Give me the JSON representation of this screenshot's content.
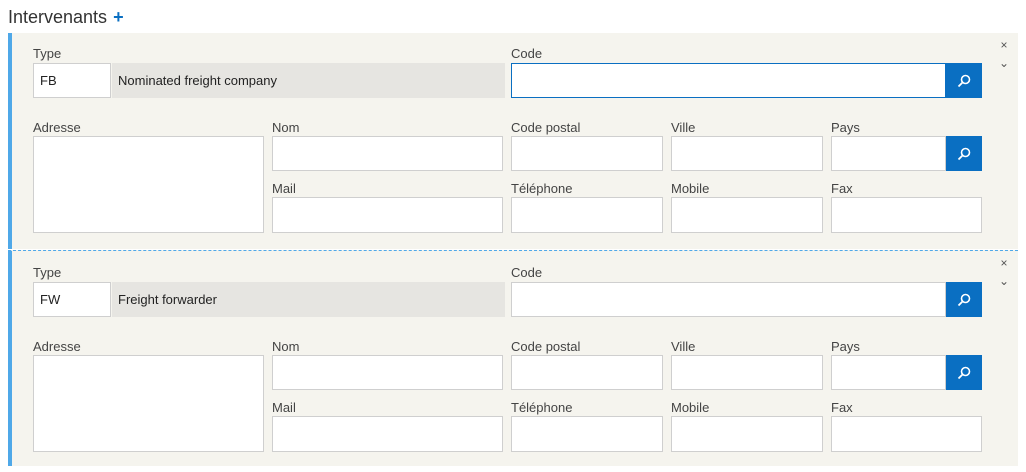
{
  "header": {
    "title": "Intervenants",
    "add_symbol": "+"
  },
  "labels": {
    "type": "Type",
    "code": "Code",
    "adresse": "Adresse",
    "nom": "Nom",
    "code_postal": "Code postal",
    "ville": "Ville",
    "pays": "Pays",
    "mail": "Mail",
    "telephone": "Téléphone",
    "mobile": "Mobile",
    "fax": "Fax"
  },
  "controls": {
    "close": "×",
    "expand": "⌄"
  },
  "intervenants": [
    {
      "type_code": "FB",
      "type_description": "Nominated freight company",
      "code": "",
      "adresse": "",
      "nom": "",
      "code_postal": "",
      "ville": "",
      "pays": "",
      "mail": "",
      "telephone": "",
      "mobile": "",
      "fax": ""
    },
    {
      "type_code": "FW",
      "type_description": "Freight forwarder",
      "code": "",
      "adresse": "",
      "nom": "",
      "code_postal": "",
      "ville": "",
      "pays": "",
      "mail": "",
      "telephone": "",
      "mobile": "",
      "fax": ""
    }
  ],
  "colors": {
    "accent": "#0a6fc2",
    "card_border": "#4fa8e8",
    "card_background": "#f5f4ee",
    "readonly_background": "#e6e5e1"
  }
}
